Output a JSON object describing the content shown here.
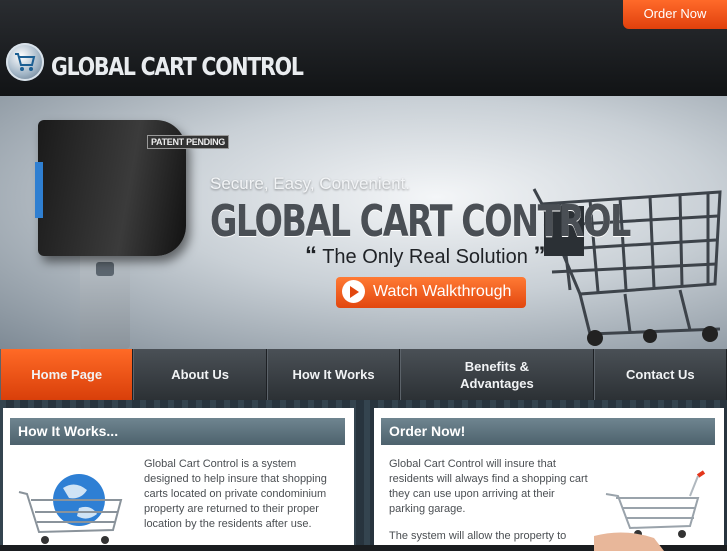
{
  "header": {
    "order_button": "Order Now",
    "logo_text": "GLOBAL CART CONTROL"
  },
  "hero": {
    "patent_badge": "PATENT PENDING",
    "tagline": "Secure, Easy, Convenient.",
    "title": "GLOBAL CART CONTROL",
    "slogan_open": "“",
    "slogan": "The Only Real Solution",
    "slogan_close": "”",
    "watch_button": "Watch Walkthrough"
  },
  "nav": {
    "items": [
      {
        "label": "Home Page",
        "active": true
      },
      {
        "label": "About Us"
      },
      {
        "label": "How It Works"
      },
      {
        "label": "Benefits & Advantages"
      },
      {
        "label": "Contact Us"
      }
    ]
  },
  "how_it_works": {
    "heading": "How It Works...",
    "text": "Global Cart Control is a system designed to help insure that shopping carts located on private condominium property are returned to their proper location by the residents after use."
  },
  "order_now": {
    "heading": "Order Now!",
    "text1": "Global Cart Control will insure that residents will always find a shopping cart they can use upon arriving at their parking garage.",
    "text2": "The system will allow the property to"
  },
  "colors": {
    "accent_orange": "#ff6a26",
    "panel_header": "#5d737e",
    "header_dark": "#1a1d20"
  }
}
